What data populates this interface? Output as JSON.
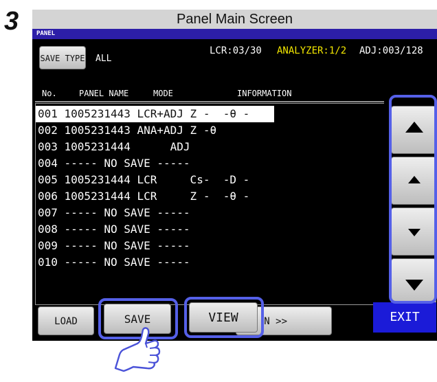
{
  "step": "3",
  "title": "Panel Main Screen",
  "panel_label": "PANEL",
  "save_type": {
    "button_label": "SAVE TYPE",
    "value": "ALL"
  },
  "counters": {
    "lcr": "LCR:03/30",
    "analyzer": "ANALYZER:1/2",
    "adj": "ADJ:003/128"
  },
  "colors": {
    "screen_bg": "#000000",
    "panel_bar": "#2c1ea8",
    "analyzer_text": "#f2e600",
    "exit_bg": "#1b1bd8",
    "highlight": "#5560e8"
  },
  "table": {
    "headers": {
      "no": "No.",
      "panel_name": "PANEL NAME",
      "mode": "MODE",
      "information": "INFORMATION"
    },
    "rows": [
      {
        "text": "001 1005231443 LCR+ADJ Z -  -θ -",
        "selected": true
      },
      {
        "text": "002 1005231443 ANA+ADJ Z -θ",
        "selected": false
      },
      {
        "text": "003 1005231444      ADJ",
        "selected": false
      },
      {
        "text": "004 ----- NO SAVE -----",
        "selected": false
      },
      {
        "text": "005 1005231444 LCR     Cs-  -D -",
        "selected": false
      },
      {
        "text": "006 1005231444 LCR     Z -  -θ -",
        "selected": false
      },
      {
        "text": "007 ----- NO SAVE -----",
        "selected": false
      },
      {
        "text": "008 ----- NO SAVE -----",
        "selected": false
      },
      {
        "text": "009 ----- NO SAVE -----",
        "selected": false
      },
      {
        "text": "010 ----- NO SAVE -----",
        "selected": false
      }
    ]
  },
  "scroll_buttons": [
    {
      "icon": "triangle-up-large"
    },
    {
      "icon": "triangle-up-small"
    },
    {
      "icon": "triangle-down-small"
    },
    {
      "icon": "triangle-down-large"
    }
  ],
  "buttons": {
    "load": "LOAD",
    "save": "SAVE",
    "view": "VIEW",
    "next_partial": "N >>",
    "exit": "EXIT"
  }
}
